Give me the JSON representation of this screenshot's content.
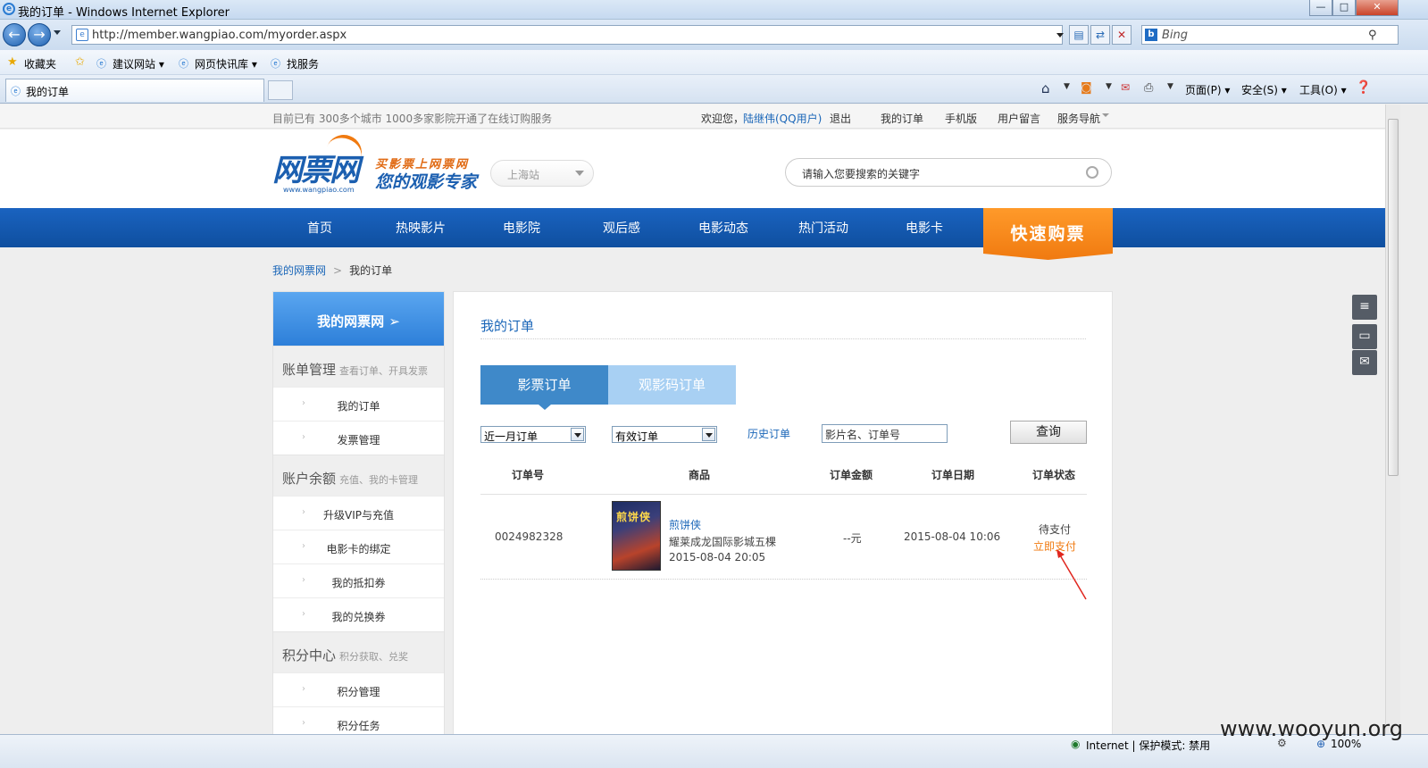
{
  "browser": {
    "title": "我的订单 - Windows Internet Explorer",
    "url": "http://member.wangpiao.com/myorder.aspx",
    "search_placeholder": "Bing",
    "favorites": [
      "收藏夹",
      "建议网站 ▾",
      "网页快讯库 ▾",
      "找服务"
    ],
    "tab_title": "我的订单",
    "commands": [
      "页面(P) ▾",
      "安全(S) ▾",
      "工具(O) ▾"
    ],
    "status_zone": "Internet | 保护模式: 禁用",
    "zoom": "100%",
    "window_buttons": [
      "—",
      "□",
      "✕"
    ]
  },
  "site": {
    "notice": "目前已有 300多个城市 1000多家影院开通了在线订购服务",
    "welcome": "欢迎您，",
    "username": "陆继伟(QQ用户)",
    "logout": "退出",
    "top_links": [
      "我的订单",
      "手机版",
      "用户留言",
      "服务导航"
    ],
    "logo_text": "网票网",
    "logo_url": "www.wangpiao.com",
    "slogan_1": "买影票上网票网",
    "slogan_2": "您的观影专家",
    "city": "上海站",
    "search_placeholder": "请输入您要搜索的关键字",
    "nav": [
      "首页",
      "热映影片",
      "电影院",
      "观后感",
      "电影动态",
      "热门活动",
      "电影卡"
    ],
    "quick_buy": "快速购票"
  },
  "breadcrumb": {
    "root": "我的网票网",
    "sep": ">",
    "current": "我的订单"
  },
  "sidebar": {
    "header": "我的网票网 ➢",
    "groups": [
      {
        "title": "账单管理",
        "desc": "查看订单、开具发票",
        "items": [
          "我的订单",
          "发票管理"
        ]
      },
      {
        "title": "账户余额",
        "desc": "充值、我的卡管理",
        "items": [
          "升级VIP与充值",
          "电影卡的绑定",
          "我的抵扣券",
          "我的兑换券"
        ]
      },
      {
        "title": "积分中心",
        "desc": "积分获取、兑奖",
        "items": [
          "积分管理",
          "积分任务"
        ]
      }
    ]
  },
  "main": {
    "heading": "我的订单",
    "tabs": [
      "影票订单",
      "观影码订单"
    ],
    "filter_period": "近一月订单",
    "filter_status": "有效订单",
    "history_link": "历史订单",
    "keyword_placeholder": "影片名、订单号",
    "query_button": "查询",
    "columns": [
      "订单号",
      "商品",
      "订单金额",
      "订单日期",
      "订单状态"
    ],
    "orders": [
      {
        "order_no": "0024982328",
        "poster_text": "煎饼侠",
        "movie": "煎饼侠",
        "cinema": "耀莱成龙国际影城五棵",
        "showtime": "2015-08-04 20:05",
        "amount": "--元",
        "date": "2015-08-04 10:06",
        "status": "待支付",
        "action": "立即支付"
      }
    ]
  },
  "watermark": "www.wooyun.org",
  "colors": {
    "brand_blue": "#1a63c0",
    "accent_orange": "#f07a10",
    "link": "#1a66b8"
  }
}
